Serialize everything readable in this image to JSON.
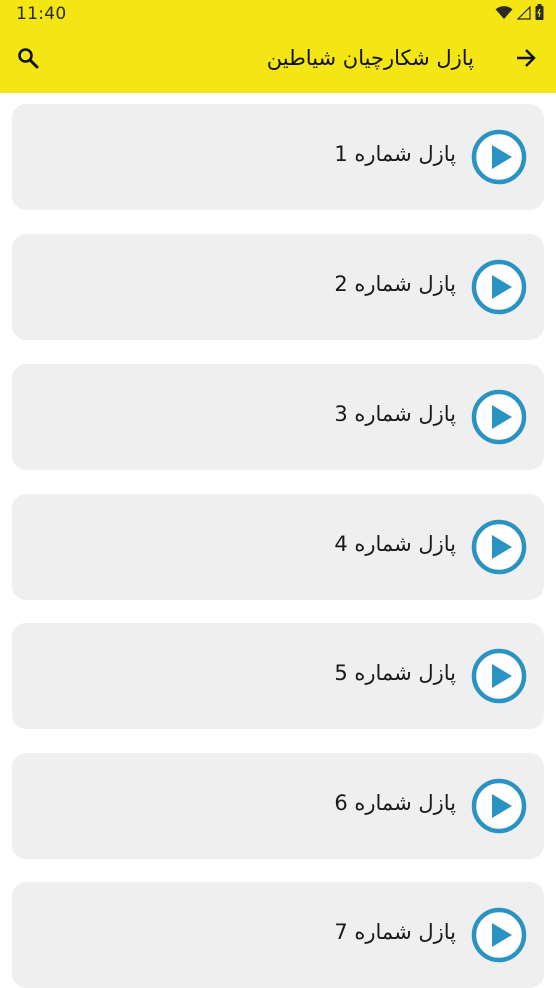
{
  "status_bar": {
    "time": "11:40",
    "icons": [
      "wifi-icon",
      "signal-icon",
      "battery-icon"
    ]
  },
  "toolbar": {
    "title": "پازل شکارچیان شیاطین",
    "search_icon": "search-icon",
    "back_icon": "arrow-right-icon"
  },
  "colors": {
    "header_bg": "#f3e614",
    "card_bg": "#efefef",
    "play_accent": "#2a93c1"
  },
  "items": [
    {
      "label": "پازل شماره 1"
    },
    {
      "label": "پازل شماره 2"
    },
    {
      "label": "پازل شماره 3"
    },
    {
      "label": "پازل شماره 4"
    },
    {
      "label": "پازل شماره 5"
    },
    {
      "label": "پازل شماره 6"
    },
    {
      "label": "پازل شماره 7"
    }
  ]
}
